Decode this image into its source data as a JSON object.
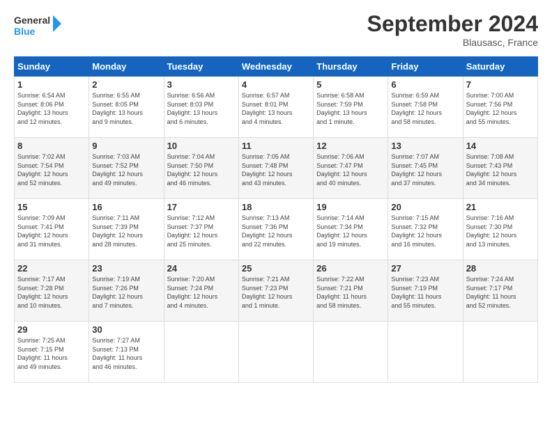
{
  "header": {
    "logo_line1": "General",
    "logo_line2": "Blue",
    "month": "September 2024",
    "location": "Blausasc, France"
  },
  "days_of_week": [
    "Sunday",
    "Monday",
    "Tuesday",
    "Wednesday",
    "Thursday",
    "Friday",
    "Saturday"
  ],
  "weeks": [
    [
      {
        "day": "1",
        "info": "Sunrise: 6:54 AM\nSunset: 8:06 PM\nDaylight: 13 hours\nand 12 minutes."
      },
      {
        "day": "2",
        "info": "Sunrise: 6:55 AM\nSunset: 8:05 PM\nDaylight: 13 hours\nand 9 minutes."
      },
      {
        "day": "3",
        "info": "Sunrise: 6:56 AM\nSunset: 8:03 PM\nDaylight: 13 hours\nand 6 minutes."
      },
      {
        "day": "4",
        "info": "Sunrise: 6:57 AM\nSunset: 8:01 PM\nDaylight: 13 hours\nand 4 minutes."
      },
      {
        "day": "5",
        "info": "Sunrise: 6:58 AM\nSunset: 7:59 PM\nDaylight: 13 hours\nand 1 minute."
      },
      {
        "day": "6",
        "info": "Sunrise: 6:59 AM\nSunset: 7:58 PM\nDaylight: 12 hours\nand 58 minutes."
      },
      {
        "day": "7",
        "info": "Sunrise: 7:00 AM\nSunset: 7:56 PM\nDaylight: 12 hours\nand 55 minutes."
      }
    ],
    [
      {
        "day": "8",
        "info": "Sunrise: 7:02 AM\nSunset: 7:54 PM\nDaylight: 12 hours\nand 52 minutes."
      },
      {
        "day": "9",
        "info": "Sunrise: 7:03 AM\nSunset: 7:52 PM\nDaylight: 12 hours\nand 49 minutes."
      },
      {
        "day": "10",
        "info": "Sunrise: 7:04 AM\nSunset: 7:50 PM\nDaylight: 12 hours\nand 46 minutes."
      },
      {
        "day": "11",
        "info": "Sunrise: 7:05 AM\nSunset: 7:48 PM\nDaylight: 12 hours\nand 43 minutes."
      },
      {
        "day": "12",
        "info": "Sunrise: 7:06 AM\nSunset: 7:47 PM\nDaylight: 12 hours\nand 40 minutes."
      },
      {
        "day": "13",
        "info": "Sunrise: 7:07 AM\nSunset: 7:45 PM\nDaylight: 12 hours\nand 37 minutes."
      },
      {
        "day": "14",
        "info": "Sunrise: 7:08 AM\nSunset: 7:43 PM\nDaylight: 12 hours\nand 34 minutes."
      }
    ],
    [
      {
        "day": "15",
        "info": "Sunrise: 7:09 AM\nSunset: 7:41 PM\nDaylight: 12 hours\nand 31 minutes."
      },
      {
        "day": "16",
        "info": "Sunrise: 7:11 AM\nSunset: 7:39 PM\nDaylight: 12 hours\nand 28 minutes."
      },
      {
        "day": "17",
        "info": "Sunrise: 7:12 AM\nSunset: 7:37 PM\nDaylight: 12 hours\nand 25 minutes."
      },
      {
        "day": "18",
        "info": "Sunrise: 7:13 AM\nSunset: 7:36 PM\nDaylight: 12 hours\nand 22 minutes."
      },
      {
        "day": "19",
        "info": "Sunrise: 7:14 AM\nSunset: 7:34 PM\nDaylight: 12 hours\nand 19 minutes."
      },
      {
        "day": "20",
        "info": "Sunrise: 7:15 AM\nSunset: 7:32 PM\nDaylight: 12 hours\nand 16 minutes."
      },
      {
        "day": "21",
        "info": "Sunrise: 7:16 AM\nSunset: 7:30 PM\nDaylight: 12 hours\nand 13 minutes."
      }
    ],
    [
      {
        "day": "22",
        "info": "Sunrise: 7:17 AM\nSunset: 7:28 PM\nDaylight: 12 hours\nand 10 minutes."
      },
      {
        "day": "23",
        "info": "Sunrise: 7:19 AM\nSunset: 7:26 PM\nDaylight: 12 hours\nand 7 minutes."
      },
      {
        "day": "24",
        "info": "Sunrise: 7:20 AM\nSunset: 7:24 PM\nDaylight: 12 hours\nand 4 minutes."
      },
      {
        "day": "25",
        "info": "Sunrise: 7:21 AM\nSunset: 7:23 PM\nDaylight: 12 hours\nand 1 minute."
      },
      {
        "day": "26",
        "info": "Sunrise: 7:22 AM\nSunset: 7:21 PM\nDaylight: 11 hours\nand 58 minutes."
      },
      {
        "day": "27",
        "info": "Sunrise: 7:23 AM\nSunset: 7:19 PM\nDaylight: 11 hours\nand 55 minutes."
      },
      {
        "day": "28",
        "info": "Sunrise: 7:24 AM\nSunset: 7:17 PM\nDaylight: 11 hours\nand 52 minutes."
      }
    ],
    [
      {
        "day": "29",
        "info": "Sunrise: 7:25 AM\nSunset: 7:15 PM\nDaylight: 11 hours\nand 49 minutes."
      },
      {
        "day": "30",
        "info": "Sunrise: 7:27 AM\nSunset: 7:13 PM\nDaylight: 11 hours\nand 46 minutes."
      },
      {
        "day": "",
        "info": ""
      },
      {
        "day": "",
        "info": ""
      },
      {
        "day": "",
        "info": ""
      },
      {
        "day": "",
        "info": ""
      },
      {
        "day": "",
        "info": ""
      }
    ]
  ]
}
